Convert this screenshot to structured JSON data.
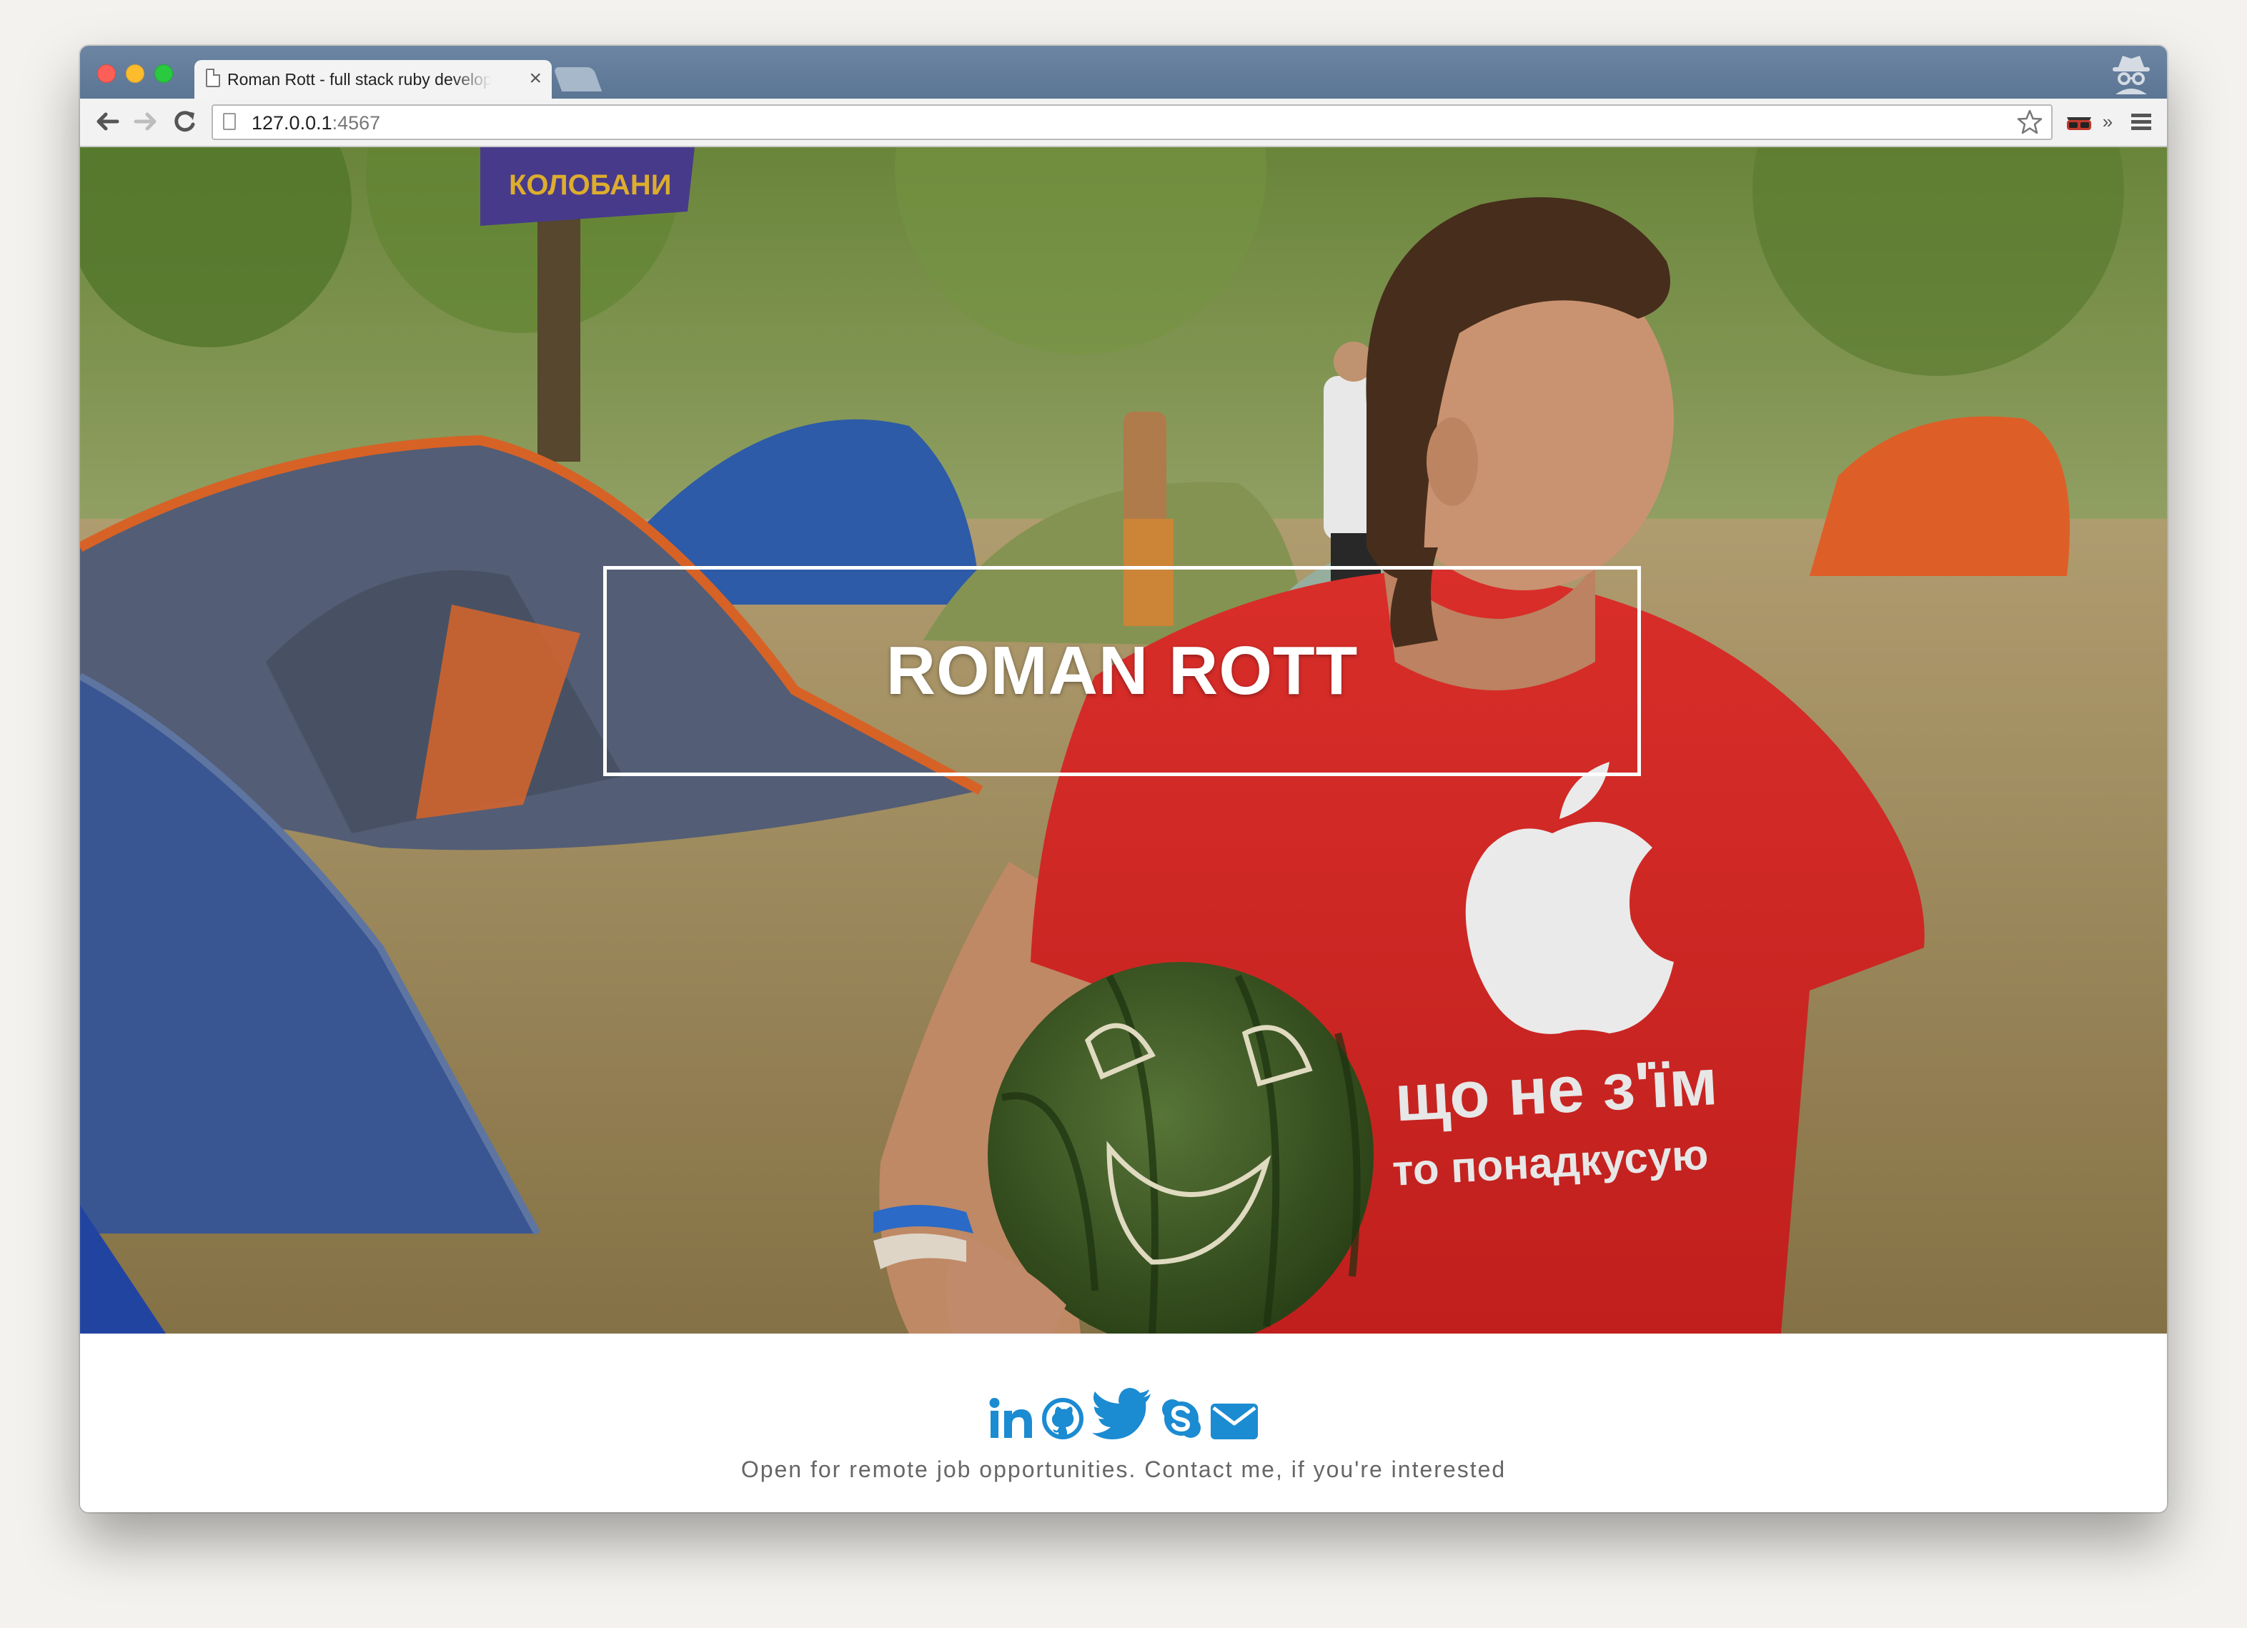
{
  "browser": {
    "tab_title": "Roman Rott - full stack ruby developer",
    "tab_close": "×",
    "url_host": "127.0.0.1",
    "url_port": ":4567",
    "overflow_chevron": "»"
  },
  "icons": {
    "back": "back-arrow-icon",
    "forward": "forward-arrow-icon",
    "reload": "reload-icon",
    "star": "bookmark-star-icon",
    "extension": "incognito-glasses-icon",
    "menu": "hamburger-menu-icon",
    "incognito": "incognito-icon"
  },
  "hero": {
    "name": "ROMAN ROTT",
    "shirt_line1": "що не з'їм",
    "shirt_line2": "то понадкусую",
    "banner_text": "КОЛОБАНИ"
  },
  "footer": {
    "social_links": [
      {
        "name": "linkedin",
        "icon": "linkedin-icon"
      },
      {
        "name": "github",
        "icon": "github-icon"
      },
      {
        "name": "twitter",
        "icon": "twitter-icon"
      },
      {
        "name": "skype",
        "icon": "skype-icon"
      },
      {
        "name": "email",
        "icon": "envelope-icon"
      }
    ],
    "tagline": "Open for remote job opportunities. Contact me, if you're interested"
  },
  "colors": {
    "social_blue": "#1b8bd2",
    "tabstrip": "#5f7a99",
    "footer_text": "#666666"
  }
}
